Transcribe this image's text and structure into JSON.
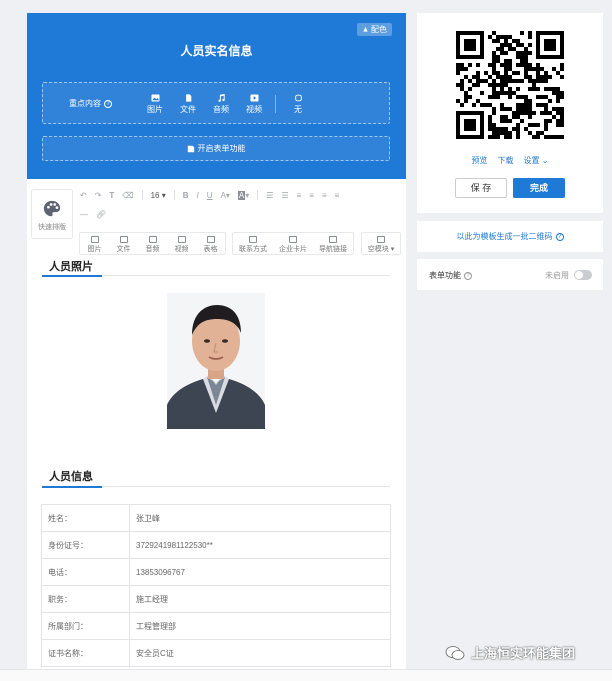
{
  "colors": {
    "primary": "#1f79d6",
    "page_bg": "#eef0f4"
  },
  "header": {
    "color_button": "配色",
    "title": "人员实名信息",
    "focus_label": "重点内容",
    "focus_options": [
      {
        "label": "图片",
        "icon": "image-icon"
      },
      {
        "label": "文件",
        "icon": "file-icon"
      },
      {
        "label": "音频",
        "icon": "audio-icon"
      },
      {
        "label": "视频",
        "icon": "video-icon"
      },
      {
        "label": "无",
        "icon": "none-icon"
      }
    ],
    "form_toggle": "开启表单功能"
  },
  "toolbar": {
    "font_size": "16",
    "quick_layout": "快速排版",
    "insert_group1": [
      "图片",
      "文件",
      "音频",
      "视频",
      "表格"
    ],
    "insert_group2": [
      "联系方式",
      "企业卡片",
      "导航链接"
    ],
    "empty_block": "空模块"
  },
  "sections": {
    "photo_title": "人员照片",
    "info_title": "人员信息"
  },
  "info_rows": [
    {
      "key": "姓名：",
      "value": "张卫峰"
    },
    {
      "key": "身份证号：",
      "value": "3729241981122530**"
    },
    {
      "key": "电话：",
      "value": "13853096767"
    },
    {
      "key": "职务：",
      "value": "施工经理"
    },
    {
      "key": "所属部门：",
      "value": "工程管理部"
    },
    {
      "key": "证书名称：",
      "value": "安全员C证"
    }
  ],
  "qr_panel": {
    "links": [
      "预览",
      "下载",
      "设置"
    ],
    "save": "保 存",
    "done": "完成"
  },
  "batch": "以此为模板生成一批二维码",
  "form_feature": {
    "label": "表单功能",
    "status": "未启用"
  },
  "watermark": "上海恒实环能集团"
}
